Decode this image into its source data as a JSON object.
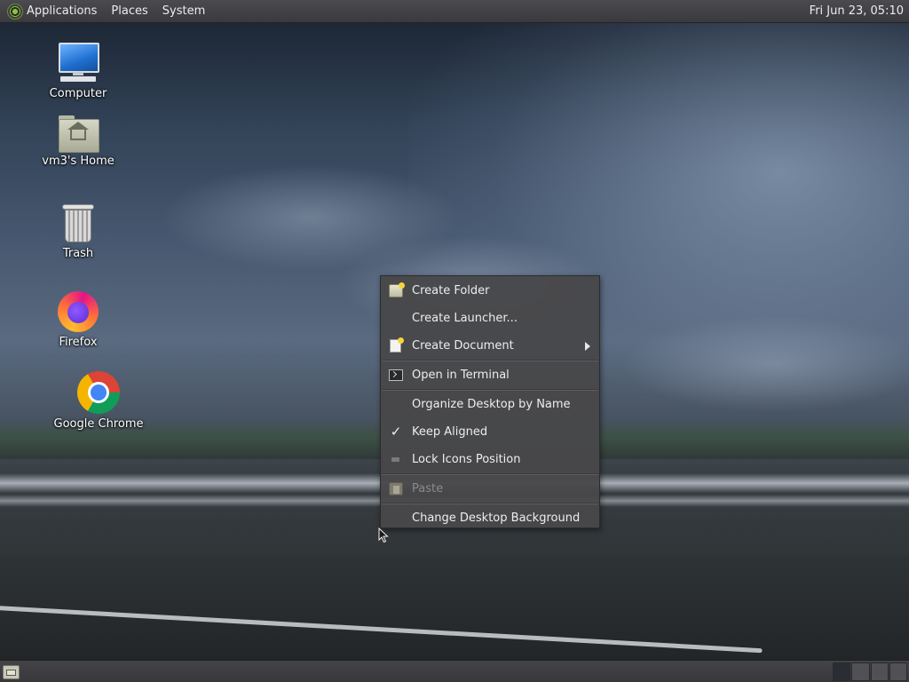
{
  "top_panel": {
    "menus": [
      "Applications",
      "Places",
      "System"
    ],
    "clock": "Fri Jun 23, 05:10"
  },
  "desktop_icons": [
    {
      "label": "Computer",
      "icon": "computer-icon"
    },
    {
      "label": "vm3's Home",
      "icon": "home-folder-icon"
    },
    {
      "label": "Trash",
      "icon": "trash-icon"
    },
    {
      "label": "Firefox",
      "icon": "firefox-icon"
    },
    {
      "label": "Google Chrome",
      "icon": "chrome-icon"
    }
  ],
  "context_menu": {
    "items": [
      {
        "label": "Create Folder",
        "icon": "folder-new-icon",
        "enabled": true
      },
      {
        "label": "Create Launcher...",
        "icon": "",
        "enabled": true
      },
      {
        "label": "Create Document",
        "icon": "document-new-icon",
        "enabled": true,
        "submenu": true
      },
      {
        "label": "Open in Terminal",
        "icon": "terminal-icon",
        "enabled": true
      },
      {
        "label": "Organize Desktop by Name",
        "icon": "",
        "enabled": true
      },
      {
        "label": "Keep Aligned",
        "icon": "checkmark-icon",
        "enabled": true,
        "checked": true
      },
      {
        "label": "Lock Icons Position",
        "icon": "unchecked-icon",
        "enabled": true,
        "checked": false
      },
      {
        "label": "Paste",
        "icon": "paste-icon",
        "enabled": false
      },
      {
        "label": "Change Desktop Background",
        "icon": "",
        "enabled": true
      }
    ],
    "checkmark_glyph": "✓"
  },
  "bottom_panel": {
    "workspaces": 4,
    "active_workspace": 1
  },
  "colors": {
    "panel": "#3a3a3e",
    "menu_bg": "#48484a",
    "menu_text": "#ededed",
    "disabled_text": "#8a8a8a"
  }
}
